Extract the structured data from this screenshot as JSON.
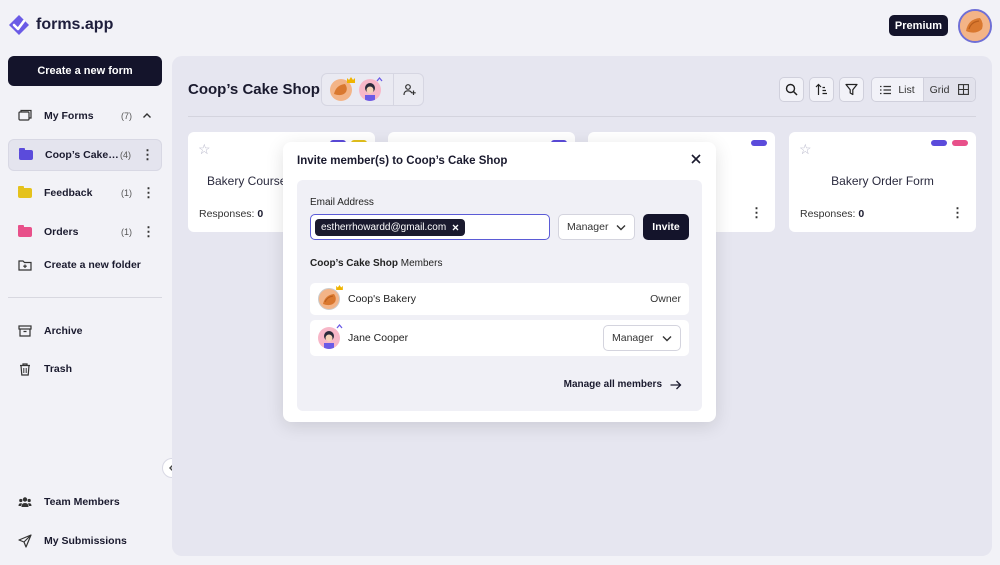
{
  "app": {
    "logo_text": "forms.app",
    "premium_label": "Premium"
  },
  "sidebar": {
    "create_form_label": "Create a new form",
    "my_forms": {
      "label": "My Forms",
      "count": "(7)"
    },
    "folders": [
      {
        "label": "Coop’s Cake Shop",
        "count": "(4)",
        "color": "#5b4bdb"
      },
      {
        "label": "Feedback",
        "count": "(1)",
        "color": "#e5c21c"
      },
      {
        "label": "Orders",
        "count": "(1)",
        "color": "#e8508a"
      }
    ],
    "create_folder_label": "Create a new folder",
    "archive_label": "Archive",
    "trash_label": "Trash",
    "team_members_label": "Team Members",
    "my_submissions_label": "My Submissions"
  },
  "main": {
    "title": "Coop’s Cake Shop",
    "view_list_label": "List",
    "view_grid_label": "Grid",
    "cards": [
      {
        "title": "Bakery Course",
        "responses_label": "Responses:",
        "responses": "0",
        "tags": [
          "#5b4bdb",
          "#e5c21c"
        ]
      },
      {
        "title": "",
        "responses_label": "",
        "responses": "",
        "tags": [
          "#5b4bdb"
        ]
      },
      {
        "title": "",
        "responses_label": "",
        "responses": "",
        "tags": [
          "#5b4bdb"
        ]
      },
      {
        "title": "Bakery Order Form",
        "responses_label": "Responses:",
        "responses": "0",
        "tags": [
          "#5b4bdb",
          "#e8508a"
        ]
      }
    ]
  },
  "modal": {
    "title": "Invite member(s) to Coop’s Cake Shop",
    "email_label": "Email Address",
    "email_chip": "estherrhowardd@gmail.com",
    "role_value": "Manager",
    "invite_label": "Invite",
    "members_heading_bold": "Coop’s Cake Shop",
    "members_heading_rest": " Members",
    "members": [
      {
        "name": "Coop's Bakery",
        "role": "Owner"
      },
      {
        "name": "Jane Cooper",
        "role": "Manager"
      }
    ],
    "manage_all_label": "Manage all members"
  }
}
